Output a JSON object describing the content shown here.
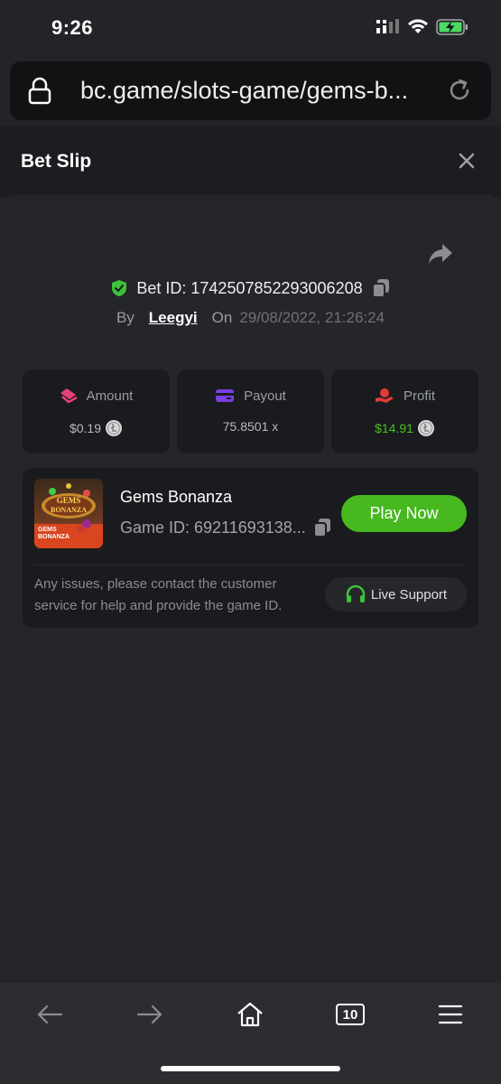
{
  "status_bar": {
    "time": "9:26"
  },
  "browser": {
    "url": "bc.game/slots-game/gems-b..."
  },
  "header": {
    "title": "Bet Slip"
  },
  "bet": {
    "id_label": "Bet ID: 1742507852293006208",
    "by_label": "By",
    "user": "Leegyi",
    "on_label": "On",
    "date": "29/08/2022, 21:26:24"
  },
  "stats": {
    "amount": {
      "label": "Amount",
      "value": "$0.19"
    },
    "payout": {
      "label": "Payout",
      "value": "75.8501 x"
    },
    "profit": {
      "label": "Profit",
      "value": "$14.91"
    }
  },
  "game": {
    "name": "Gems Bonanza",
    "id_label": "Game ID: 69211693138...",
    "thumb_text_top": "GEMS BONANZA",
    "thumb_text_bottom": "GEMS BONANZA",
    "play_label": "Play Now",
    "help_text": "Any issues, please contact the customer service for help and provide the game ID.",
    "support_label": "Live Support"
  },
  "nav": {
    "tabs_count": "10"
  },
  "colors": {
    "accent_green": "#47b81f",
    "profit_green": "#49c01f",
    "verified_green": "#3cc13b",
    "amount_pink": "#e8417a",
    "payout_purple": "#7b3fe4",
    "profit_red": "#e23b3b"
  },
  "icons": [
    "lock-icon",
    "reload-icon",
    "close-icon",
    "share-icon",
    "verified-shield-icon",
    "copy-icon",
    "coin-icon",
    "headset-icon",
    "back-icon",
    "forward-icon",
    "home-icon",
    "tabs-icon",
    "menu-icon"
  ]
}
